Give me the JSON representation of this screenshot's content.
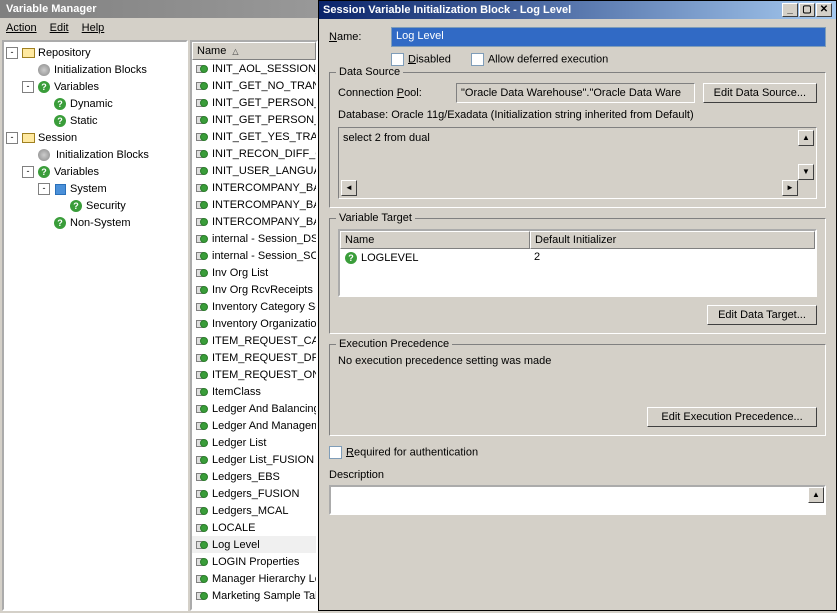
{
  "mainWindow": {
    "title": "Variable Manager",
    "menu": {
      "action": "Action",
      "edit": "Edit",
      "help": "Help"
    }
  },
  "tree": {
    "repository": "Repository",
    "repo_init": "Initialization Blocks",
    "repo_vars": "Variables",
    "repo_dynamic": "Dynamic",
    "repo_static": "Static",
    "session": "Session",
    "sess_init": "Initialization Blocks",
    "sess_vars": "Variables",
    "system": "System",
    "security": "Security",
    "nonsystem": "Non-System"
  },
  "list": {
    "header": "Name",
    "items": [
      "INIT_AOL_SESSION_",
      "INIT_GET_NO_TRAN",
      "INIT_GET_PERSON_",
      "INIT_GET_PERSON_",
      "INIT_GET_YES_TRA",
      "INIT_RECON_DIFF_C",
      "INIT_USER_LANGUA",
      "INTERCOMPANY_BA",
      "INTERCOMPANY_BA",
      "INTERCOMPANY_BA",
      "internal - Session_DSN",
      "internal - Session_SCH",
      "Inv Org List",
      "Inv Org RcvReceipts l",
      "Inventory Category Se",
      "Inventory Organization",
      "ITEM_REQUEST_CA",
      "ITEM_REQUEST_DR",
      "ITEM_REQUEST_ON",
      "ItemClass",
      "Ledger And Balancing",
      "Ledger And Managem",
      "Ledger List",
      "Ledger List_FUSION",
      "Ledgers_EBS",
      "Ledgers_FUSION",
      "Ledgers_MCAL",
      "LOCALE",
      "Log Level",
      "LOGIN Properties",
      "Manager Hierarchy Le",
      "Marketing Sample Tab"
    ],
    "selectedIndex": 28
  },
  "dialog": {
    "title": "Session Variable Initialization Block - Log Level",
    "nameLabel": "Name:",
    "nameValue": "Log Level",
    "disabled": "Disabled",
    "allowDeferred": "Allow deferred execution",
    "dataSource": {
      "legend": "Data Source",
      "poolLabel": "Connection Pool:",
      "poolValue": "\"Oracle Data Warehouse\".\"Oracle Data Ware",
      "editBtn": "Edit Data Source...",
      "dbLabel": "Database: Oracle 11g/Exadata (Initialization string inherited from Default)",
      "sql": "select 2 from dual"
    },
    "varTarget": {
      "legend": "Variable Target",
      "colName": "Name",
      "colInit": "Default Initializer",
      "rowName": "LOGLEVEL",
      "rowInit": "2",
      "editBtn": "Edit Data Target..."
    },
    "execPrec": {
      "legend": "Execution Precedence",
      "text": "No execution precedence setting was made",
      "editBtn": "Edit Execution Precedence..."
    },
    "reqAuth": "Required for authentication",
    "description": "Description"
  }
}
